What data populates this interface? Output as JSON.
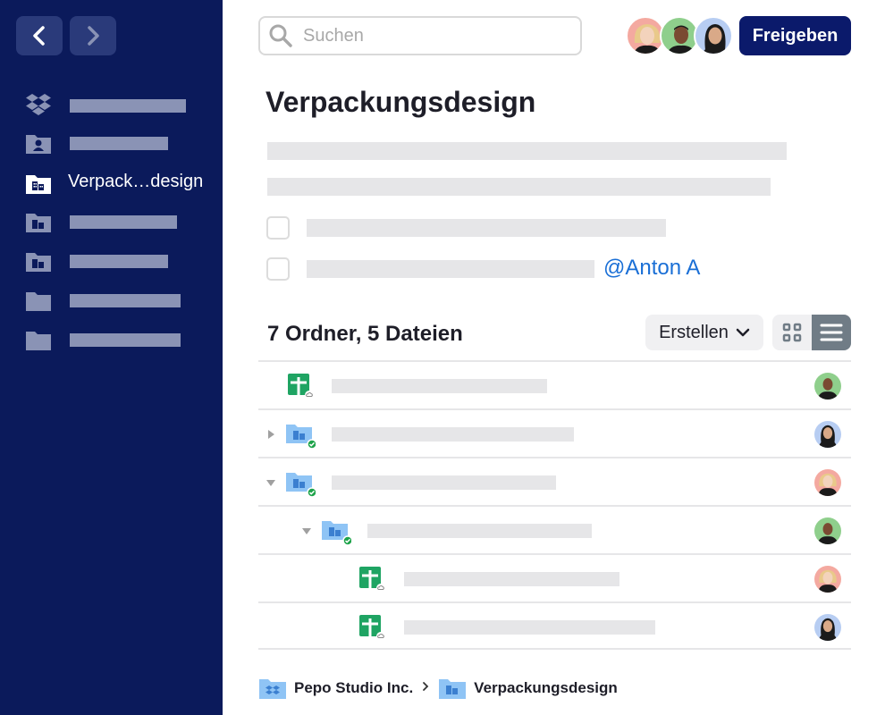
{
  "search": {
    "placeholder": "Suchen",
    "value": ""
  },
  "header": {
    "share_label": "Freigeben"
  },
  "sidebar": {
    "active_label": "Verpack…design"
  },
  "page": {
    "title": "Verpackungsdesign",
    "mention": "@Anton A"
  },
  "files": {
    "summary": "7 Ordner, 5 Dateien",
    "create_label": "Erstellen"
  },
  "breadcrumb": {
    "root": "Pepo Studio Inc.",
    "current": "Verpackungsdesign"
  },
  "colors": {
    "sidebar": "#0b1a5b",
    "accent": "#0b1a6b",
    "mention": "#1a6fd6",
    "sheet_green": "#1fa463",
    "folder_blue": "#8fc4f5",
    "sync_green": "#1ea34a"
  }
}
